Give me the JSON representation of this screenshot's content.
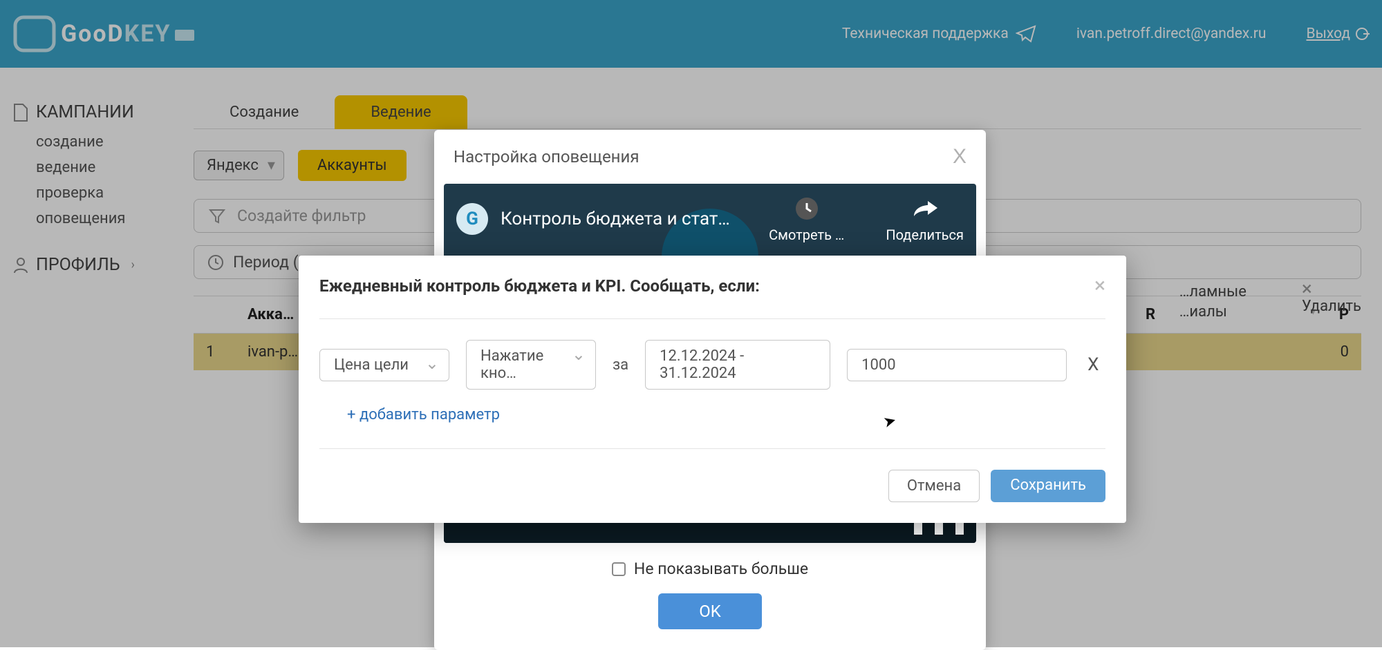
{
  "header": {
    "brand_part1": "GooD",
    "brand_part2": "KEY",
    "support_label": "Техническая поддержка",
    "user_email": "ivan.petroff.direct@yandex.ru",
    "logout_label": "Выход"
  },
  "sidebar": {
    "campaigns_title": "КАМПАНИИ",
    "items": [
      "создание",
      "ведение",
      "проверка",
      "оповещения"
    ],
    "profile_title": "ПРОФИЛЬ"
  },
  "tabs": {
    "create": "Создание",
    "manage": "Ведение"
  },
  "toolbar": {
    "provider": "Яндекс",
    "accounts_btn": "Аккаунты"
  },
  "filter": {
    "placeholder": "Создайте фильтр"
  },
  "period": {
    "label_prefix": "Период ("
  },
  "table": {
    "col_account": "Акка…",
    "col_r": "R",
    "col_p": "P",
    "rows": [
      {
        "n": "1",
        "account": "ivan-p…",
        "p": "0"
      }
    ]
  },
  "right_crumbs": {
    "materials_line1": "…ламные",
    "materials_line2": "…иалы",
    "delete_label": "Удалить"
  },
  "modal_notif": {
    "title": "Настройка оповещения",
    "video_title": "Контроль бюджета и стат…",
    "watch_label": "Смотреть …",
    "share_label": "Поделиться",
    "dont_show": "Не показывать больше",
    "ok": "OK"
  },
  "modal_kpi": {
    "title": "Ежедневный контроль бюджета и KPI. Сообщать, если:",
    "sel_metric": "Цена цели",
    "sel_goal": "Нажатие кно…",
    "za": "за",
    "date_range": "12.12.2024 - 31.12.2024",
    "value": "1000",
    "row_remove": "X",
    "add_param": "+ добавить параметр",
    "cancel": "Отмена",
    "save": "Сохранить"
  },
  "colors": {
    "header_bg": "#3ba5cb",
    "accent_yellow": "#f9ca00",
    "primary_blue": "#5c9fd6"
  }
}
